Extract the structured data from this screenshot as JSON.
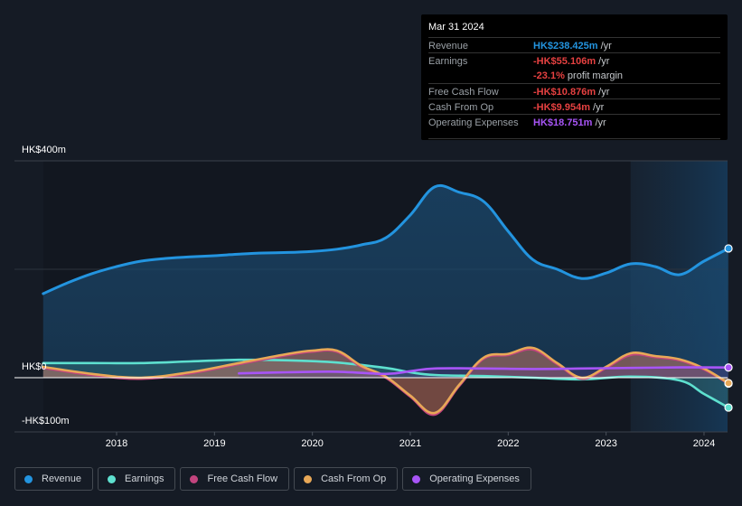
{
  "tooltip": {
    "date": "Mar 31 2024",
    "rows": [
      {
        "label": "Revenue",
        "value": "HK$238.425m",
        "unit": " /yr",
        "color": "#2394df"
      },
      {
        "label": "Earnings",
        "value": "-HK$55.106m",
        "unit": " /yr",
        "color": "#e64141"
      },
      {
        "label": "",
        "value": "-23.1%",
        "unit": " profit margin",
        "color": "#e64141"
      },
      {
        "label": "Free Cash Flow",
        "value": "-HK$10.876m",
        "unit": " /yr",
        "color": "#e64141"
      },
      {
        "label": "Cash From Op",
        "value": "-HK$9.954m",
        "unit": " /yr",
        "color": "#e64141"
      },
      {
        "label": "Operating Expenses",
        "value": "HK$18.751m",
        "unit": " /yr",
        "color": "#a855f7"
      }
    ]
  },
  "legend": [
    {
      "label": "Revenue",
      "color": "#2394df"
    },
    {
      "label": "Earnings",
      "color": "#5ee0cf"
    },
    {
      "label": "Free Cash Flow",
      "color": "#c2447e"
    },
    {
      "label": "Cash From Op",
      "color": "#e8a857"
    },
    {
      "label": "Operating Expenses",
      "color": "#a855f7"
    }
  ],
  "chart_data": {
    "type": "area",
    "title": "",
    "xlabel": "",
    "ylabel": "",
    "y_tick_labels": [
      "HK$400m",
      "HK$0",
      "-HK$100m"
    ],
    "y_ticks": [
      400,
      0,
      -100
    ],
    "x_tick_labels": [
      "2018",
      "2019",
      "2020",
      "2021",
      "2022",
      "2023",
      "2024"
    ],
    "x_ticks": [
      2018,
      2019,
      2020,
      2021,
      2022,
      2023,
      2024
    ],
    "xlim": [
      2017.25,
      2024.25
    ],
    "ylim": [
      -100,
      400
    ],
    "highlight_from": 2023.25,
    "series": [
      {
        "name": "Revenue",
        "color": "#2394df",
        "x": [
          2017.25,
          2017.5,
          2017.75,
          2018.0,
          2018.25,
          2018.5,
          2018.75,
          2019.0,
          2019.25,
          2019.5,
          2019.75,
          2020.0,
          2020.25,
          2020.5,
          2020.75,
          2021.0,
          2021.25,
          2021.5,
          2021.75,
          2022.0,
          2022.25,
          2022.5,
          2022.75,
          2023.0,
          2023.25,
          2023.5,
          2023.75,
          2024.0,
          2024.25
        ],
        "values": [
          155,
          175,
          192,
          205,
          215,
          220,
          223,
          225,
          228,
          230,
          231,
          233,
          237,
          245,
          258,
          300,
          352,
          342,
          325,
          270,
          218,
          200,
          183,
          193,
          210,
          205,
          190,
          215,
          238.4
        ]
      },
      {
        "name": "Earnings",
        "color": "#5ee0cf",
        "x": [
          2017.25,
          2017.75,
          2018.25,
          2018.75,
          2019.25,
          2019.75,
          2020.25,
          2020.75,
          2021.0,
          2021.25,
          2021.75,
          2022.25,
          2022.75,
          2023.25,
          2023.75,
          2024.0,
          2024.25
        ],
        "values": [
          27,
          27,
          27,
          30,
          33,
          32,
          28,
          18,
          10,
          5,
          3,
          0,
          -3,
          2,
          -5,
          -30,
          -55.1
        ]
      },
      {
        "name": "Free Cash Flow",
        "color": "#c2447e",
        "x": [
          2017.25,
          2017.75,
          2018.25,
          2018.75,
          2019.25,
          2019.75,
          2020.0,
          2020.25,
          2020.5,
          2020.75,
          2021.0,
          2021.25,
          2021.5,
          2021.75,
          2022.0,
          2022.25,
          2022.5,
          2022.75,
          2023.0,
          2023.25,
          2023.5,
          2023.75,
          2024.0,
          2024.25
        ],
        "values": [
          18,
          5,
          -2,
          8,
          25,
          42,
          48,
          48,
          20,
          0,
          -35,
          -68,
          -15,
          35,
          42,
          52,
          25,
          -2,
          18,
          42,
          38,
          32,
          15,
          -10.9
        ]
      },
      {
        "name": "Cash From Op",
        "color": "#e8a857",
        "x": [
          2017.25,
          2017.75,
          2018.25,
          2018.75,
          2019.25,
          2019.75,
          2020.0,
          2020.25,
          2020.5,
          2020.75,
          2021.0,
          2021.25,
          2021.5,
          2021.75,
          2022.0,
          2022.25,
          2022.5,
          2022.75,
          2023.0,
          2023.25,
          2023.5,
          2023.75,
          2024.0,
          2024.25
        ],
        "values": [
          20,
          7,
          0,
          10,
          27,
          44,
          50,
          50,
          22,
          2,
          -33,
          -65,
          -13,
          37,
          44,
          55,
          27,
          0,
          20,
          45,
          40,
          34,
          17,
          -10
        ]
      },
      {
        "name": "Operating Expenses",
        "color": "#a855f7",
        "x": [
          2019.25,
          2019.75,
          2020.25,
          2020.75,
          2021.0,
          2021.25,
          2021.75,
          2022.25,
          2022.75,
          2023.25,
          2023.75,
          2024.25
        ],
        "values": [
          8,
          10,
          11,
          7,
          12,
          17,
          17,
          16,
          17,
          18,
          19,
          18.8
        ]
      }
    ]
  }
}
